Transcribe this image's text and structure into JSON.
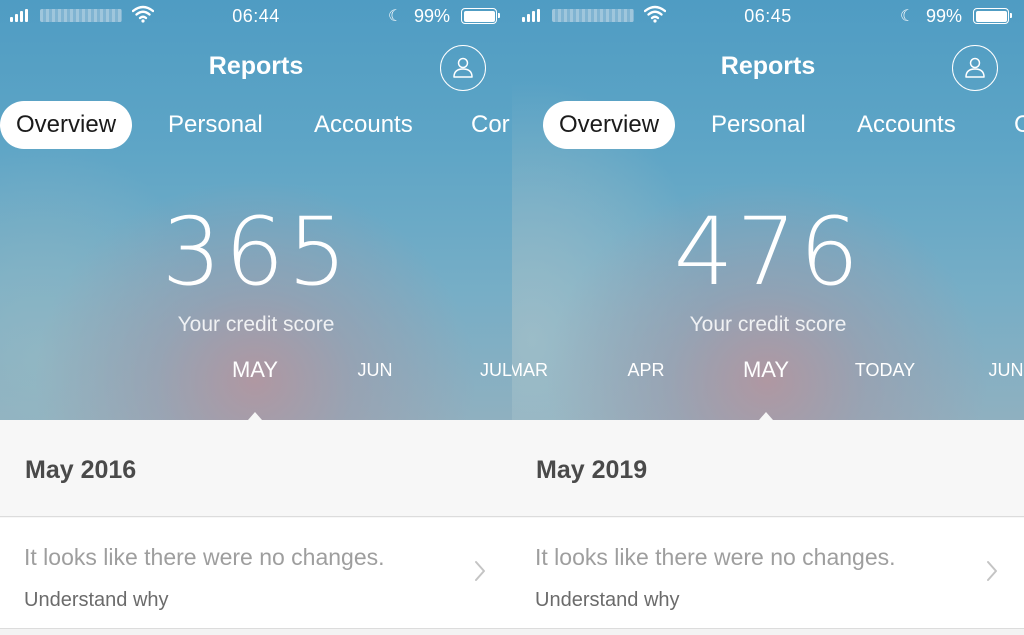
{
  "screens": [
    {
      "status_bar": {
        "time": "06:44",
        "battery_percent": "99%",
        "do_not_disturb_icon": "moon-icon",
        "signal_icon": "cellular-signal-icon",
        "wifi_icon": "wifi-icon",
        "battery_icon": "battery-icon"
      },
      "nav": {
        "title": "Reports",
        "profile_icon": "person-icon"
      },
      "tabs": [
        {
          "label": "Overview",
          "active": true
        },
        {
          "label": "Personal",
          "active": false
        },
        {
          "label": "Accounts",
          "active": false
        },
        {
          "label": "Cor",
          "active": false
        }
      ],
      "score": {
        "value": "365",
        "label": "Your credit score"
      },
      "months": [
        {
          "label": "MAY",
          "active": true
        },
        {
          "label": "JUN",
          "active": false
        },
        {
          "label": "JUL",
          "active": false
        }
      ],
      "period": {
        "title": "May 2016"
      },
      "change": {
        "text": "It looks like there were no changes.",
        "link": "Understand why",
        "chevron_icon": "chevron-right-icon"
      }
    },
    {
      "status_bar": {
        "time": "06:45",
        "battery_percent": "99%",
        "do_not_disturb_icon": "moon-icon",
        "signal_icon": "cellular-signal-icon",
        "wifi_icon": "wifi-icon",
        "battery_icon": "battery-icon"
      },
      "nav": {
        "title": "Reports",
        "profile_icon": "person-icon"
      },
      "tabs": [
        {
          "label": "Overview",
          "active": true
        },
        {
          "label": "Personal",
          "active": false
        },
        {
          "label": "Accounts",
          "active": false
        },
        {
          "label": "C",
          "active": false
        }
      ],
      "score": {
        "value": "476",
        "label": "Your credit score"
      },
      "months": [
        {
          "label": "MAR",
          "active": false
        },
        {
          "label": "APR",
          "active": false
        },
        {
          "label": "MAY",
          "active": true
        },
        {
          "label": "TODAY",
          "active": false
        },
        {
          "label": "JUN",
          "active": false
        }
      ],
      "period": {
        "title": "May 2019"
      },
      "change": {
        "text": "It looks like there were no changes.",
        "link": "Understand why",
        "chevron_icon": "chevron-right-icon"
      }
    }
  ],
  "colors": {
    "hero_blue": "#5ea5c6",
    "hero_pink": "#b296a0",
    "active_tab_bg": "#ffffff",
    "period_title": "#4a4a4a",
    "muted_text": "#9e9e9e"
  }
}
